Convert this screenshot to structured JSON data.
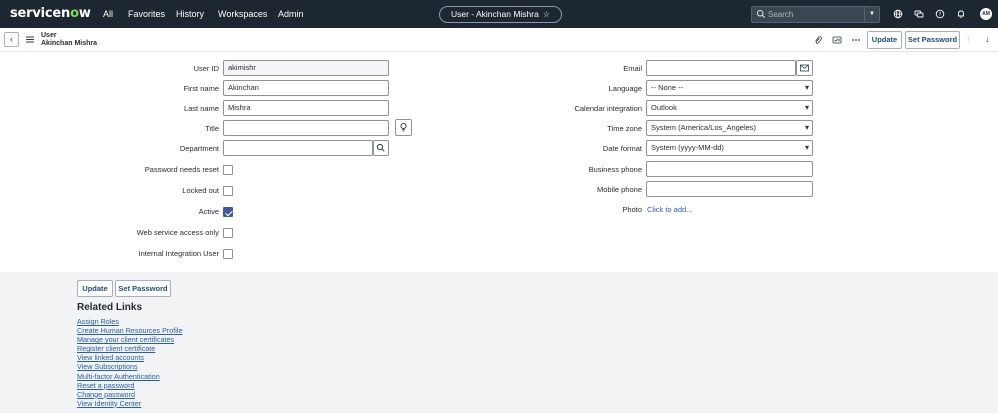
{
  "nav": {
    "logo": "servicenow",
    "links": [
      "All",
      "Favorites",
      "History",
      "Workspaces",
      "Admin"
    ],
    "record_title": "User - Akinchan Mishra",
    "search_placeholder": "Search",
    "avatar_initials": "AM"
  },
  "header": {
    "type": "User",
    "name": "Akinchan Mishra",
    "update_label": "Update",
    "set_password_label": "Set Password"
  },
  "form": {
    "left": {
      "user_id": {
        "label": "User ID",
        "value": "akimishr"
      },
      "first_name": {
        "label": "First name",
        "value": "Akinchan"
      },
      "last_name": {
        "label": "Last name",
        "value": "Mishra"
      },
      "title": {
        "label": "Title",
        "value": ""
      },
      "department": {
        "label": "Department",
        "value": ""
      },
      "password_needs_reset": {
        "label": "Password needs reset",
        "checked": false
      },
      "locked_out": {
        "label": "Locked out",
        "checked": false
      },
      "active": {
        "label": "Active",
        "checked": true
      },
      "web_service_access_only": {
        "label": "Web service access only",
        "checked": false
      },
      "internal_integration_user": {
        "label": "Internal Integration User",
        "checked": false
      }
    },
    "right": {
      "email": {
        "label": "Email",
        "value": ""
      },
      "language": {
        "label": "Language",
        "value": "-- None --"
      },
      "calendar_integration": {
        "label": "Calendar integration",
        "value": "Outlook"
      },
      "time_zone": {
        "label": "Time zone",
        "value": "System (America/Los_Angeles)"
      },
      "date_format": {
        "label": "Date format",
        "value": "System (yyyy-MM-dd)"
      },
      "business_phone": {
        "label": "Business phone",
        "value": ""
      },
      "mobile_phone": {
        "label": "Mobile phone",
        "value": ""
      },
      "photo": {
        "label": "Photo",
        "link": "Click to add..."
      }
    }
  },
  "bottom": {
    "update_label": "Update",
    "set_password_label": "Set Password",
    "related_links_title": "Related Links",
    "related_links": [
      "Assign Roles",
      "Create Human Resources Profile",
      "Manage your client certificates",
      "Register client certificate",
      "View linked accounts",
      "View Subscriptions",
      "Multi-factor Authentication",
      "Reset a password",
      "Change password",
      "View Identity Center"
    ]
  },
  "colors": {
    "nav_bg": "#1d2731",
    "link": "#2a5ca8",
    "button_text": "#1f4b7a",
    "checkbox_checked": "#3d5a96"
  }
}
